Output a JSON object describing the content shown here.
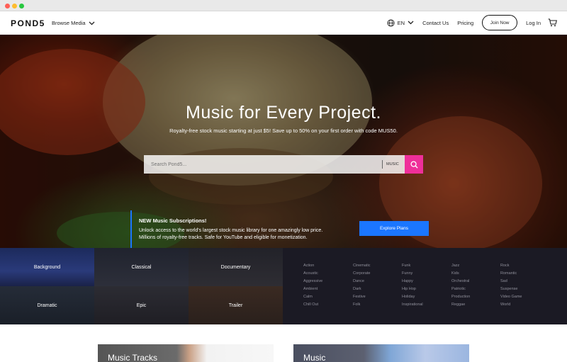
{
  "browser": {
    "controls": [
      "close",
      "minimize",
      "maximize"
    ]
  },
  "nav": {
    "logo": "POND5",
    "browse_label": "Browse Media",
    "lang": "EN",
    "contact": "Contact Us",
    "pricing": "Pricing",
    "join": "Join Now",
    "login": "Log In",
    "icons": [
      "chevron-down-icon",
      "globe-icon",
      "cart-icon"
    ]
  },
  "hero": {
    "title": "Music for Every Project.",
    "subtitle": "Royalty-free stock music starting at just $5! Save up to 50% on your first order with code MUS50.",
    "search_placeholder": "Search Pond5...",
    "search_type": "MUSIC",
    "accent": "#ef2f9a"
  },
  "promo": {
    "title": "NEW Music Subscriptions!",
    "line1": "Unlock access to the world's largest stock music library for one amazingly low price.",
    "line2": "Millions of royalty-free tracks. Safe for YouTube and eligible for monetization.",
    "button": "Explore Plans",
    "accent": "#1b76ff"
  },
  "genres": {
    "tiles": [
      "Background",
      "Classical",
      "Documentary",
      "Dramatic",
      "Epic",
      "Trailer"
    ],
    "moods": [
      [
        "Action",
        "Acoustic",
        "Aggressive",
        "Ambient",
        "Calm",
        "Chill Out"
      ],
      [
        "Cinematic",
        "Corporate",
        "Dance",
        "Dark",
        "Festive",
        "Folk"
      ],
      [
        "Funk",
        "Funny",
        "Happy",
        "Hip Hop",
        "Holiday",
        "Inspirational"
      ],
      [
        "Jazz",
        "Kids",
        "Orchestral",
        "Patriotic",
        "Production",
        "Reggae"
      ],
      [
        "Rock",
        "Romantic",
        "Sad",
        "Suspense",
        "Video Game",
        "World"
      ]
    ]
  },
  "cards": [
    "Music Tracks",
    "Music"
  ]
}
